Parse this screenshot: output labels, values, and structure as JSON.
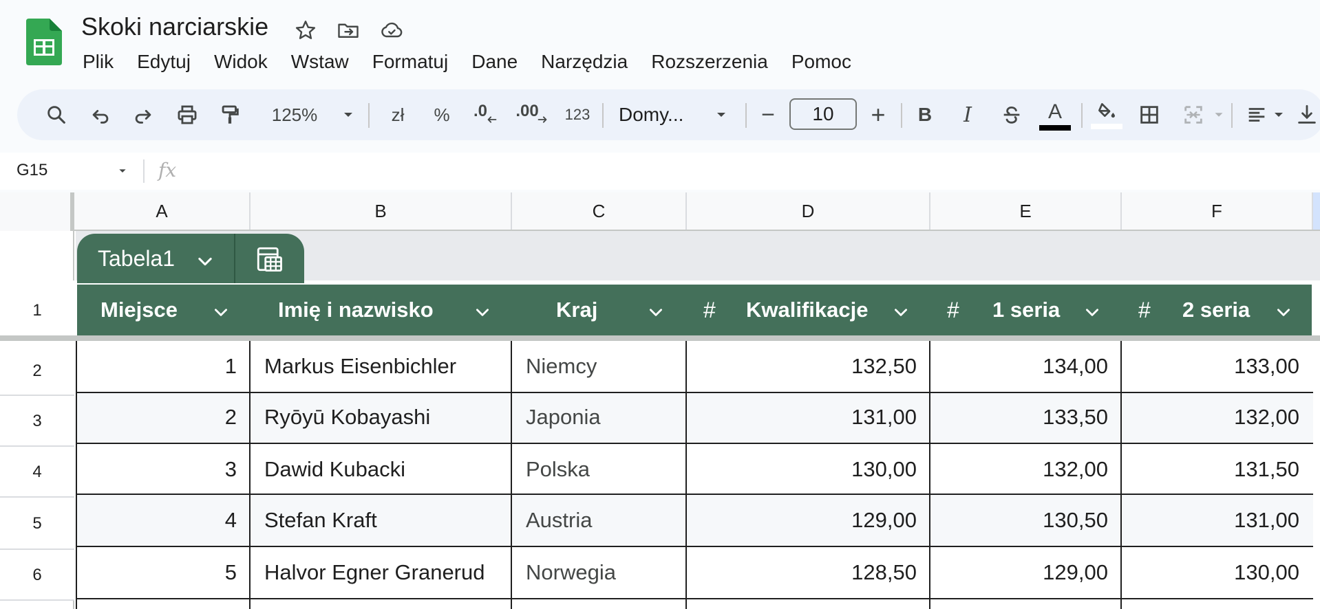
{
  "app": {
    "title": "Skoki narciarskie",
    "icons": [
      "sheets-logo",
      "star-icon",
      "move-to-folder-icon",
      "cloud-saved-icon"
    ]
  },
  "menu": [
    "Plik",
    "Edytuj",
    "Widok",
    "Wstaw",
    "Formatuj",
    "Dane",
    "Narzędzia",
    "Rozszerzenia",
    "Pomoc"
  ],
  "toolbar": {
    "zoom": "125%",
    "currency": "zł",
    "percent": "%",
    "dec_decrease": ".0",
    "dec_increase": ".00",
    "number_format": "123",
    "font": "Domy...",
    "font_size": "10",
    "minus": "−",
    "plus": "+",
    "bold": "B",
    "italic": "I",
    "text_color_letter": "A",
    "text_color": "#000000"
  },
  "formula_bar": {
    "cell_ref": "G15",
    "fx": "fx"
  },
  "columns": [
    "A",
    "B",
    "C",
    "D",
    "E",
    "F"
  ],
  "rows": [
    "1",
    "2",
    "3",
    "4",
    "5",
    "6"
  ],
  "table": {
    "name": "Tabela1",
    "header_color": "#44705a",
    "headers": [
      "Miejsce",
      "Imię i nazwisko",
      "Kraj",
      "Kwalifikacje",
      "1 seria",
      "2 seria"
    ],
    "numeric_marker": "#",
    "data": [
      [
        "1",
        "Markus Eisenbichler",
        "Niemcy",
        "132,50",
        "134,00",
        "133,00"
      ],
      [
        "2",
        "Ryōyū Kobayashi",
        "Japonia",
        "131,00",
        "133,50",
        "132,00"
      ],
      [
        "3",
        "Dawid Kubacki",
        "Polska",
        "130,00",
        "132,00",
        "131,50"
      ],
      [
        "4",
        "Stefan Kraft",
        "Austria",
        "129,00",
        "130,50",
        "131,00"
      ],
      [
        "5",
        "Halvor Egner Granerud",
        "Norwegia",
        "128,50",
        "129,00",
        "130,00"
      ]
    ]
  }
}
